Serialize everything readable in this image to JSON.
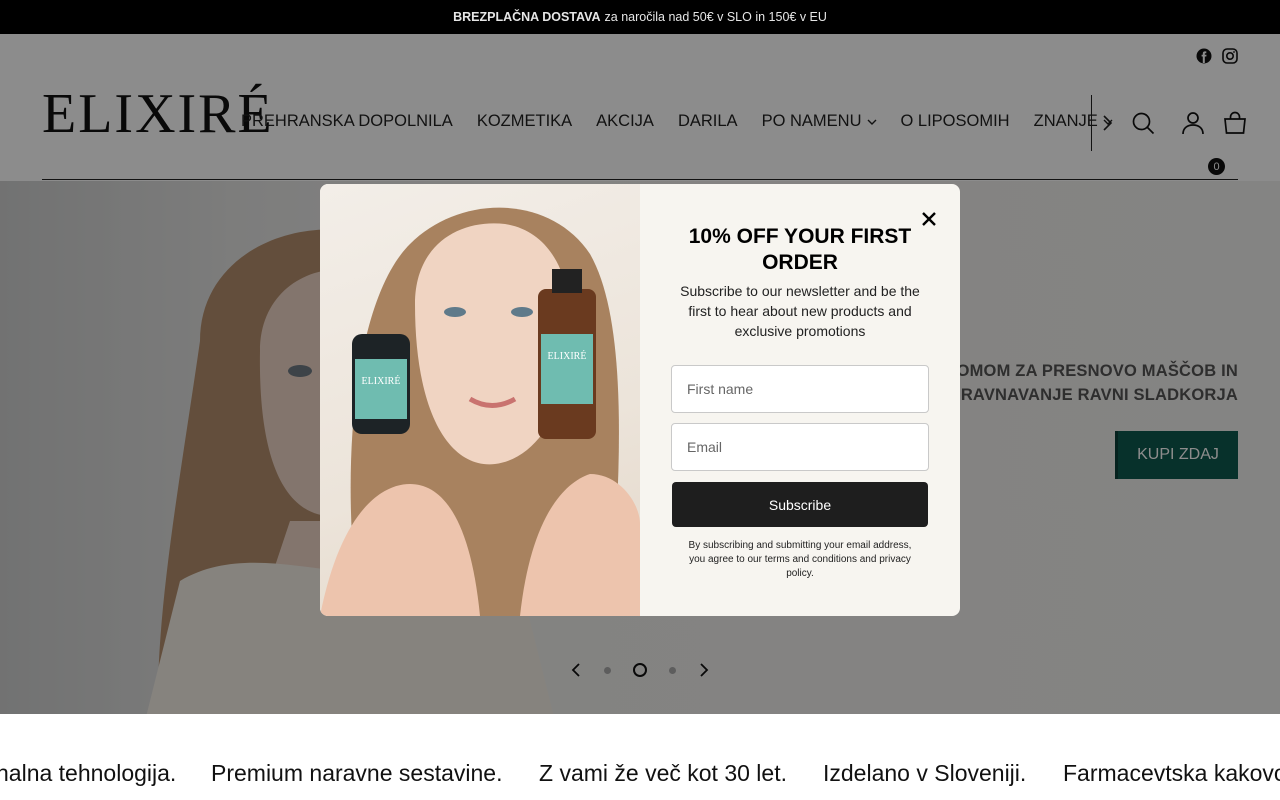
{
  "announcement": {
    "bold": "BREZPLAČNA DOSTAVA",
    "rest": "za naročila nad 50€ v SLO in 150€ v EU"
  },
  "header": {
    "logo": "ELIXIRÉ",
    "social": [
      "facebook-icon",
      "instagram-icon"
    ],
    "nav": [
      "PREHRANSKA DOPOLNILA",
      "KOZMETIKA",
      "AKCIJA",
      "DARILA",
      "PO NAMENU",
      "O LIPOSOMIH",
      "ZNANJE"
    ],
    "cart_count": "0"
  },
  "hero": {
    "line1": "ROMOM ZA PRESNOVO MAŠČOB IN",
    "line2": "URAVNAVANJE RAVNI SLADKORJA",
    "cta": "KUPI ZDAJ",
    "slides": 3,
    "active_slide": 2
  },
  "marquee": [
    "nalna tehnologija.",
    "Premium naravne sestavine.",
    "Z vami že več kot 30 let.",
    "Izdelano v Sloveniji.",
    "Farmacevtska kakovo"
  ],
  "modal": {
    "title": "10% OFF YOUR FIRST ORDER",
    "subtitle": "Subscribe to our newsletter and be the first to hear about new products and exclusive promotions",
    "first_name_placeholder": "First name",
    "email_placeholder": "Email",
    "subscribe": "Subscribe",
    "legal": "By subscribing and submitting your email address, you agree to our terms and conditions and privacy policy.",
    "bottle_label_left": "ELIXIRÉ",
    "bottle_label_right": "ELIXIRÉ"
  },
  "colors": {
    "accent": "#0d5a4f",
    "button_dark": "#1e1e1e"
  }
}
